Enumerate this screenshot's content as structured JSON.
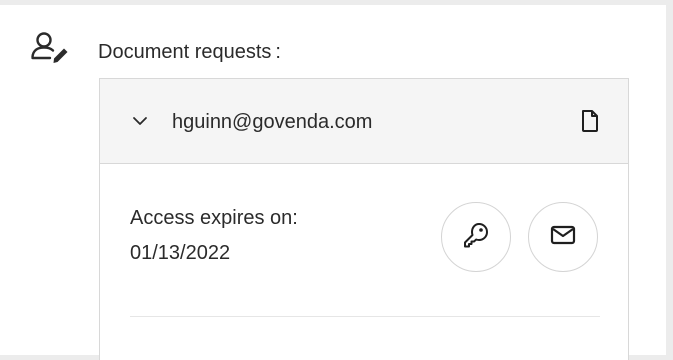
{
  "section": {
    "icon": "user-edit-icon",
    "label": "Document requests :"
  },
  "request": {
    "email": "hguinn@govenda.com",
    "expand_icon": "chevron-down-icon",
    "document_icon": "document-icon",
    "access_expires_label": "Access expires on:",
    "access_expires_date": "01/13/2022",
    "actions": [
      {
        "name": "key-button",
        "icon": "key-icon"
      },
      {
        "name": "email-button",
        "icon": "envelope-icon"
      }
    ]
  },
  "colors": {
    "page_background": "#ececec",
    "panel_background": "#ffffff",
    "header_background": "#f5f5f5",
    "border": "#d8d8d8",
    "text": "#2b2b2b"
  }
}
